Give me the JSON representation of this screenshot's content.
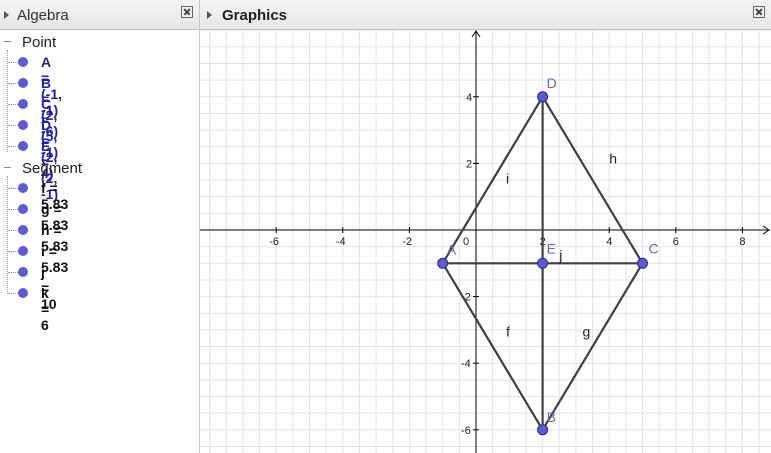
{
  "algebra": {
    "title": "Algebra",
    "categories": [
      {
        "label": "Point",
        "items": [
          {
            "text": "A = (-1, -1)"
          },
          {
            "text": "B = (2, -6)"
          },
          {
            "text": "C = (5, -1)"
          },
          {
            "text": "D = (2, 4)"
          },
          {
            "text": "E = (2, -1)"
          }
        ]
      },
      {
        "label": "Segment",
        "items": [
          {
            "text": "f = 5.83"
          },
          {
            "text": "g = 5.83"
          },
          {
            "text": "h = 5.83"
          },
          {
            "text": "i = 5.83"
          },
          {
            "text": "j = 10"
          },
          {
            "text": "k = 6"
          }
        ]
      }
    ]
  },
  "graphics": {
    "title": "Graphics",
    "x_ticks": [
      "-6",
      "-4",
      "-2",
      "0",
      "2",
      "4",
      "6",
      "8"
    ],
    "y_ticks": [
      "4",
      "2",
      "-2",
      "-4",
      "-6"
    ],
    "xlim": [
      -8.3,
      8.8
    ],
    "ylim": [
      -6.7,
      6.0
    ],
    "points": [
      {
        "name": "A",
        "x": -1,
        "y": -1
      },
      {
        "name": "B",
        "x": 2,
        "y": -6
      },
      {
        "name": "C",
        "x": 5,
        "y": -1
      },
      {
        "name": "D",
        "x": 2,
        "y": 4
      },
      {
        "name": "E",
        "x": 2,
        "y": -1
      }
    ],
    "segments": [
      {
        "name": "f",
        "from": "A",
        "to": "B"
      },
      {
        "name": "g",
        "from": "B",
        "to": "C"
      },
      {
        "name": "h",
        "from": "C",
        "to": "D"
      },
      {
        "name": "i",
        "from": "D",
        "to": "A"
      },
      {
        "name": "j",
        "from": "B",
        "to": "D"
      },
      {
        "name": "k",
        "from": "A",
        "to": "C"
      }
    ],
    "colors": {
      "point": "#5b5bd6",
      "segment": "#404040",
      "grid": "#e4e4e4",
      "point_label": "#6a6ab8"
    }
  }
}
